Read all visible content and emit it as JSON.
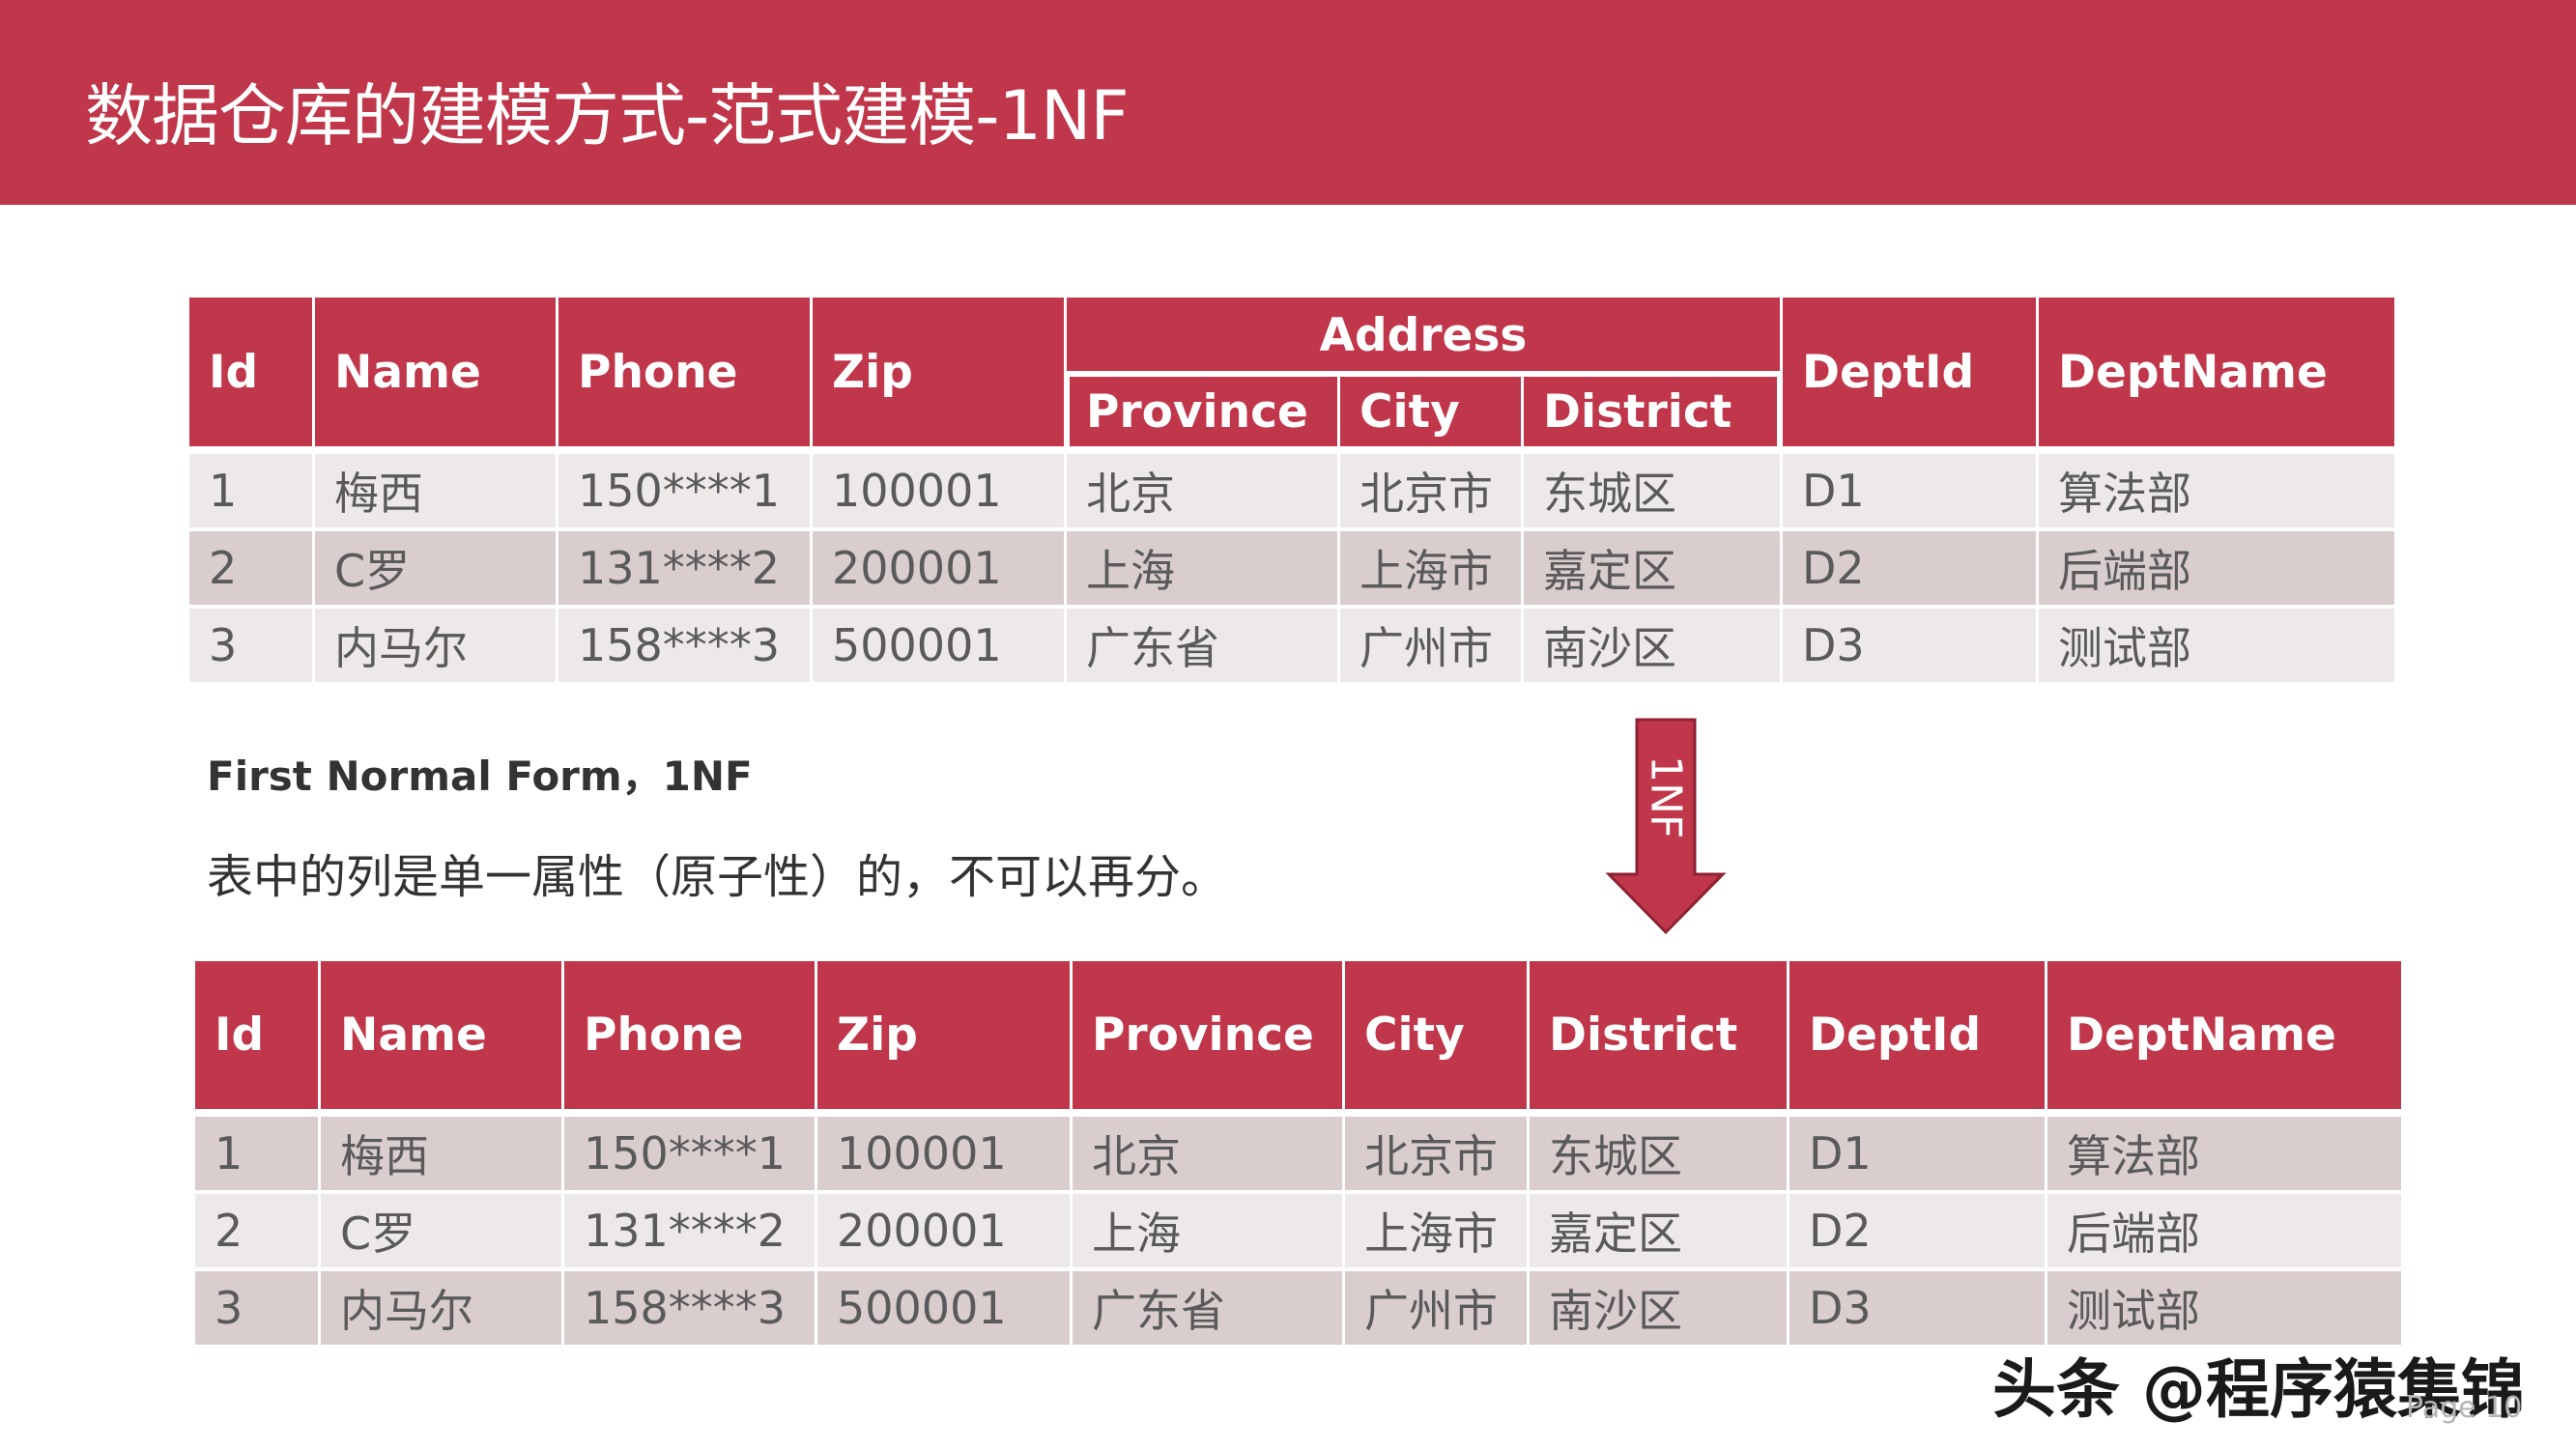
{
  "title": "数据仓库的建模方式-范式建模-1NF",
  "colors": {
    "brand": "#c0364a",
    "row_light": "#eee9e9",
    "row_dark": "#d9cdcd",
    "cell_text": "#5a5a5a"
  },
  "top_table": {
    "group_header": "Address",
    "headers": [
      "Id",
      "Name",
      "Phone",
      "Zip",
      "Province",
      "City",
      "District",
      "DeptId",
      "DeptName"
    ],
    "rows": [
      [
        "1",
        "梅西",
        "150****1",
        "100001",
        "北京",
        "北京市",
        "东城区",
        "D1",
        "算法部"
      ],
      [
        "2",
        "C罗",
        "131****2",
        "200001",
        "上海",
        "上海市",
        "嘉定区",
        "D2",
        "后端部"
      ],
      [
        "3",
        "内马尔",
        "158****3",
        "500001",
        "广东省",
        "广州市",
        "南沙区",
        "D3",
        "测试部"
      ]
    ]
  },
  "definition": {
    "heading": "First Normal Form，1NF",
    "description": "表中的列是单一属性（原子性）的，不可以再分。"
  },
  "arrow": {
    "label": "1NF",
    "icon": "arrow-down-icon"
  },
  "bottom_table": {
    "headers": [
      "Id",
      "Name",
      "Phone",
      "Zip",
      "Province",
      "City",
      "District",
      "DeptId",
      "DeptName"
    ],
    "rows": [
      [
        "1",
        "梅西",
        "150****1",
        "100001",
        "北京",
        "北京市",
        "东城区",
        "D1",
        "算法部"
      ],
      [
        "2",
        "C罗",
        "131****2",
        "200001",
        "上海",
        "上海市",
        "嘉定区",
        "D2",
        "后端部"
      ],
      [
        "3",
        "内马尔",
        "158****3",
        "500001",
        "广东省",
        "广州市",
        "南沙区",
        "D3",
        "测试部"
      ]
    ]
  },
  "watermark": "头条 @程序猿集锦",
  "page_label": "Page 10"
}
